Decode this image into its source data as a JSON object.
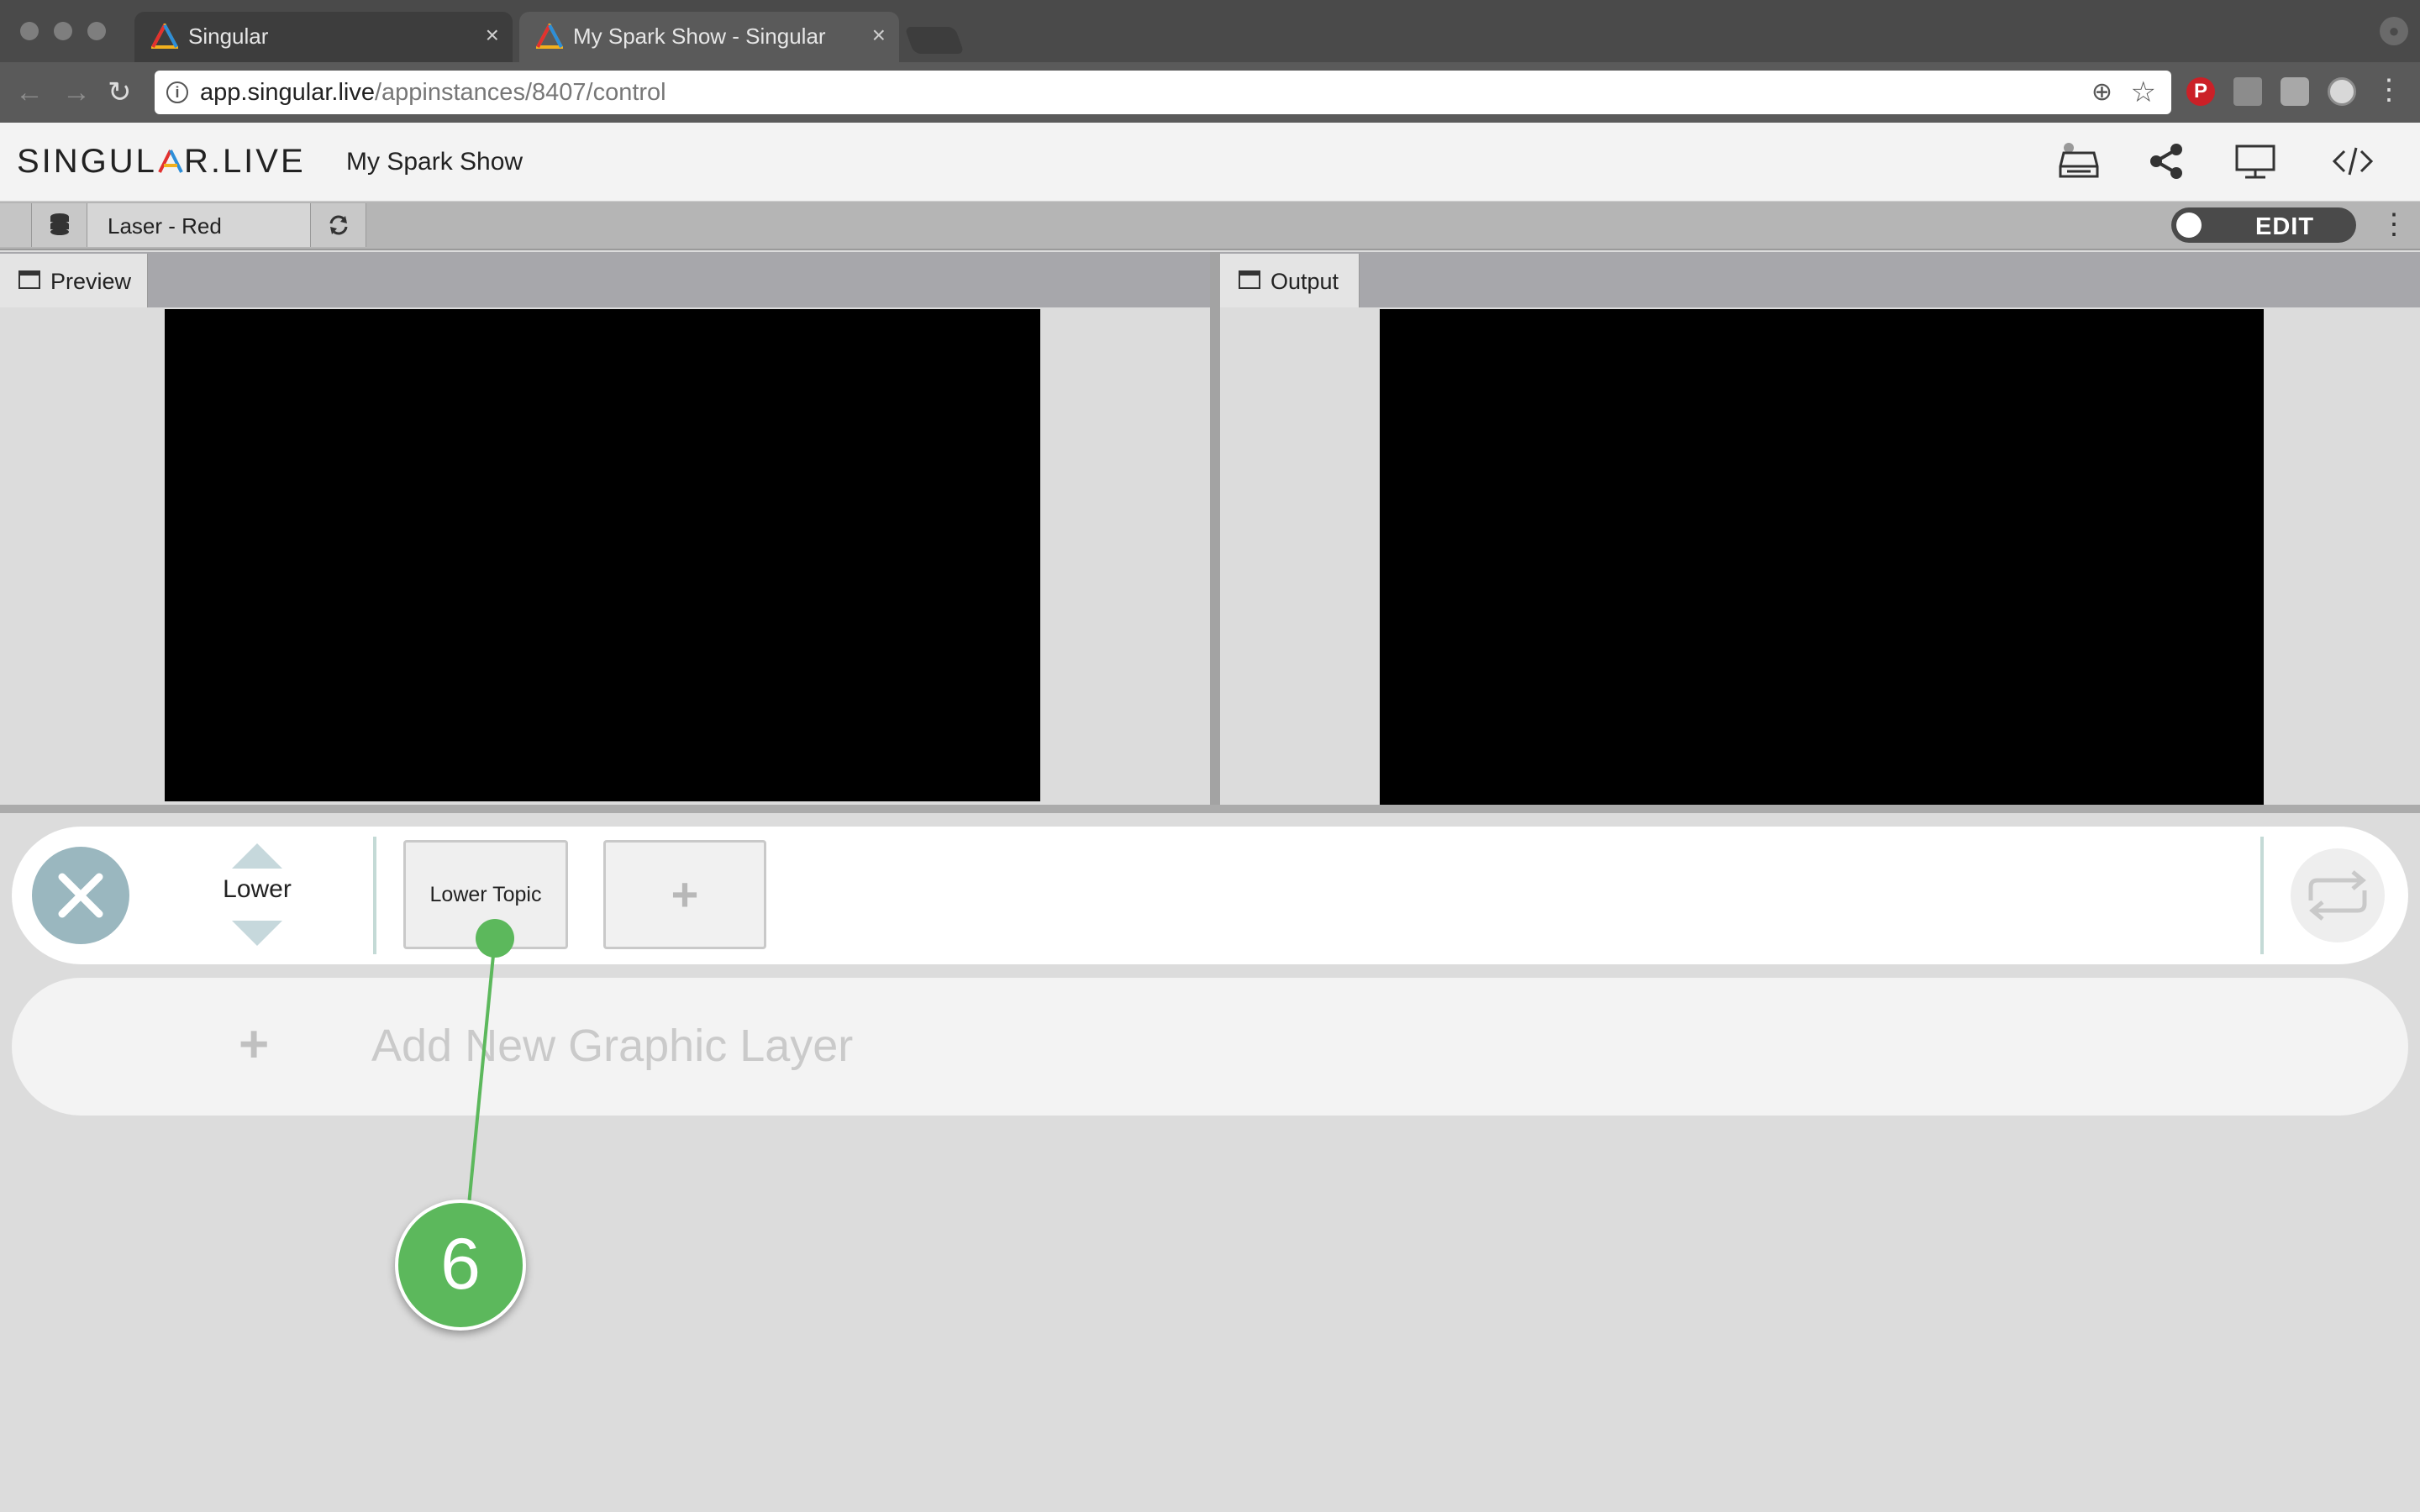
{
  "browser": {
    "tabs": [
      {
        "title": "Singular",
        "active": false
      },
      {
        "title": "My Spark Show - Singular",
        "active": true
      }
    ],
    "close_glyph": "×",
    "url_host": "app.singular.live",
    "url_path": "/appinstances/8407/control",
    "icons": {
      "back": "back-arrow-icon",
      "forward": "forward-arrow-icon",
      "reload": "reload-icon",
      "zoom": "zoom-icon",
      "bookmark": "star-icon",
      "menu": "kebab-menu-icon"
    },
    "extensions": [
      "pinterest-icon",
      "extension-icon",
      "extension-icon",
      "extension-icon"
    ]
  },
  "app": {
    "logo_pre": "SINGUL",
    "logo_post": "R.LIVE",
    "show_title": "My Spark Show",
    "header_icons": [
      "inbox-icon",
      "share-icon",
      "monitor-icon",
      "code-icon"
    ]
  },
  "toolbar": {
    "data_field": "Laser - Red",
    "mode_label": "EDIT",
    "more_glyph": "⋮"
  },
  "panels": {
    "preview_label": "Preview",
    "output_label": "Output"
  },
  "layer": {
    "name": "Lower",
    "subcompositions": [
      {
        "label": "Lower Topic"
      }
    ],
    "add_subcomp_glyph": "+"
  },
  "add_layer": {
    "glyph": "+",
    "label": "Add New Graphic Layer"
  },
  "annotation": {
    "step_number": "6",
    "color": "#5cb85c"
  }
}
